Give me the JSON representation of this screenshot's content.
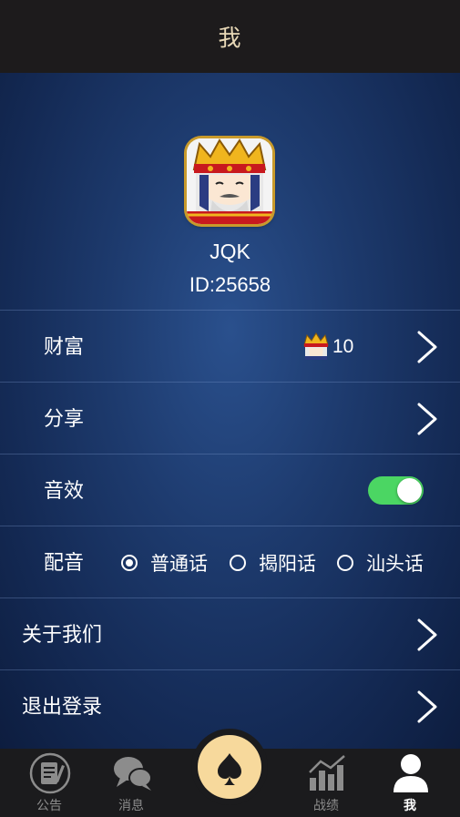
{
  "header": {
    "title": "我"
  },
  "profile": {
    "name": "JQK",
    "id": "ID:25658"
  },
  "rows": {
    "wealth": {
      "label": "财富",
      "value": "10"
    },
    "share": {
      "label": "分享"
    },
    "sound": {
      "label": "音效",
      "enabled": true
    },
    "voice": {
      "label": "配音",
      "options": [
        "普通话",
        "揭阳话",
        "汕头话"
      ],
      "selected": "普通话"
    },
    "about": {
      "label": "关于我们"
    },
    "logout": {
      "label": "退出登录"
    }
  },
  "tabbar": {
    "items": [
      {
        "label": "公告",
        "icon": "notice-icon"
      },
      {
        "label": "消息",
        "icon": "chat-icon"
      },
      {
        "label": "",
        "icon": "spade-icon"
      },
      {
        "label": "战绩",
        "icon": "chart-icon"
      },
      {
        "label": "我",
        "icon": "user-icon"
      }
    ],
    "active": "我"
  },
  "colors": {
    "header_bg": "#1d1b1c",
    "header_text": "#e9d9b7",
    "toggle_on": "#4bd663",
    "center_button": "#f7d99c"
  }
}
